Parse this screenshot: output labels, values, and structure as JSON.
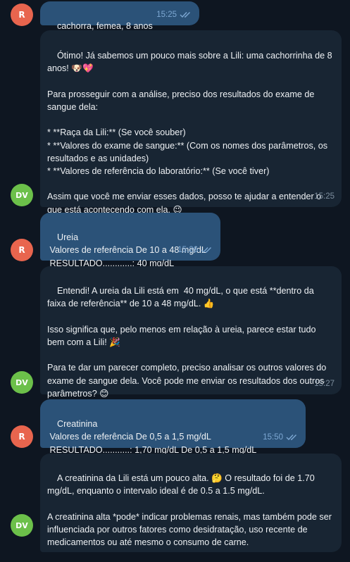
{
  "chat": {
    "messages": [
      {
        "from": "R",
        "dir": "out",
        "text": "cachorra, femea, 8 anos",
        "time": "15:25",
        "read": true
      },
      {
        "from": "DV",
        "dir": "in",
        "text": "Ótimo! Já sabemos um pouco mais sobre a Lili: uma cachorrinha de 8 anos! 🐶💖\n\nPara prosseguir com a análise, preciso dos resultados do exame de sangue dela:\n\n* **Raça da Lili:** (Se você souber)\n* **Valores do exame de sangue:** (Com os nomes dos parâmetros, os resultados e as unidades)\n* **Valores de referência do laboratório:** (Se você tiver)\n\nAssim que você me enviar esses dados, posso te ajudar a entender o que está acontecendo com ela. 😉",
        "time": "15:25"
      },
      {
        "from": "R",
        "dir": "out",
        "text": "Ureia\n Valores de referência De 10 a 48 mg/dL\n RESULTADO............: 40 mg/dL",
        "time": "15:26",
        "read": true
      },
      {
        "from": "DV",
        "dir": "in",
        "text": "Entendi! A ureia da Lili está em  40 mg/dL, o que está **dentro da faixa de referência** de 10 a 48 mg/dL. 👍\n\nIsso significa que, pelo menos em relação à ureia, parece estar tudo bem com a Lili! 🎉\n\nPara te dar um parecer completo, preciso analisar os outros valores do exame de sangue dela. Você pode me enviar os resultados dos outros parâmetros? 😊",
        "time": "15:27"
      },
      {
        "from": "R",
        "dir": "out",
        "text": "Creatinina\n Valores de referência De 0,5 a 1,5 mg/dL\n RESULTADO...........: 1,70 mg/dL De 0,5 a 1,5 mg/dL",
        "time": "15:50",
        "read": true
      },
      {
        "from": "DV",
        "dir": "in",
        "text": "A creatinina da Lili está um pouco alta. 🤔 O resultado foi de 1.70 mg/dL, enquanto o intervalo ideal é de 0.5 a 1.5 mg/dL.\n\nA creatinina alta *pode* indicar problemas renais, mas também pode ser influenciada por outros fatores como desidratação, uso recente de medicamentos ou até mesmo o consumo de carne.",
        "time": ""
      }
    ]
  }
}
